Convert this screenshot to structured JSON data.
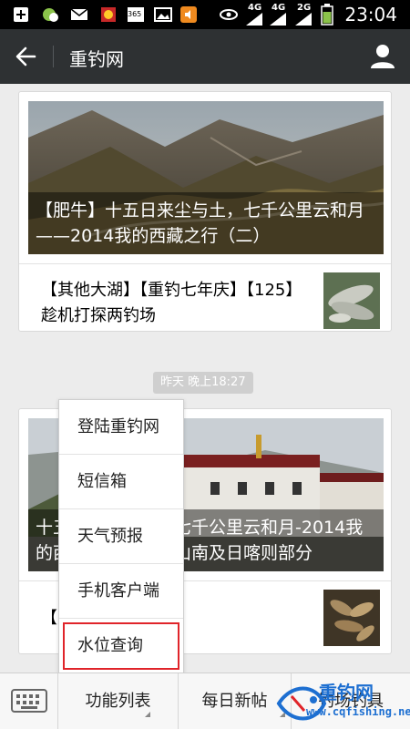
{
  "status_bar": {
    "time": "23:04",
    "net1": "4G",
    "net2": "4G",
    "net3": "2G",
    "icons": [
      "add-icon",
      "wechat-icon",
      "mail-icon",
      "game-icon",
      "calendar-icon",
      "gallery-icon",
      "audio-icon",
      "eye-icon",
      "signal-icon",
      "battery-icon"
    ],
    "calendar_label": "365"
  },
  "header": {
    "title": "重钓网"
  },
  "feed": {
    "card1": {
      "hero_caption": "【肥牛】十五日来尘与土，七千公里云和月——2014我的西藏之行（二）",
      "item_title": "【其他大湖】【重钓七年庆】【125】趁机打探两钓场"
    },
    "timestamp": "昨天 晚上18:27",
    "card2": {
      "hero_caption": "十五日来尘与土，七千公里云和月-2014我的西藏之行（四）山南及日喀则部分",
      "item_title": "【重钓】九湖"
    }
  },
  "popup_menu": {
    "items": [
      {
        "label": "登陆重钓网"
      },
      {
        "label": "短信箱"
      },
      {
        "label": "天气预报"
      },
      {
        "label": "手机客户端"
      },
      {
        "label": "水位查询"
      }
    ],
    "highlighted_index": 4
  },
  "bottom_bar": {
    "tabs": [
      {
        "label": "功能列表"
      },
      {
        "label": "每日新帖"
      },
      {
        "label": "钓场钓具"
      }
    ]
  },
  "watermark": {
    "brand": "重钓网",
    "url": "www.cqfishing.net"
  },
  "colors": {
    "title_bar": "#2e3133",
    "highlight": "#e0242a",
    "watermark": "#1d6fd1"
  }
}
